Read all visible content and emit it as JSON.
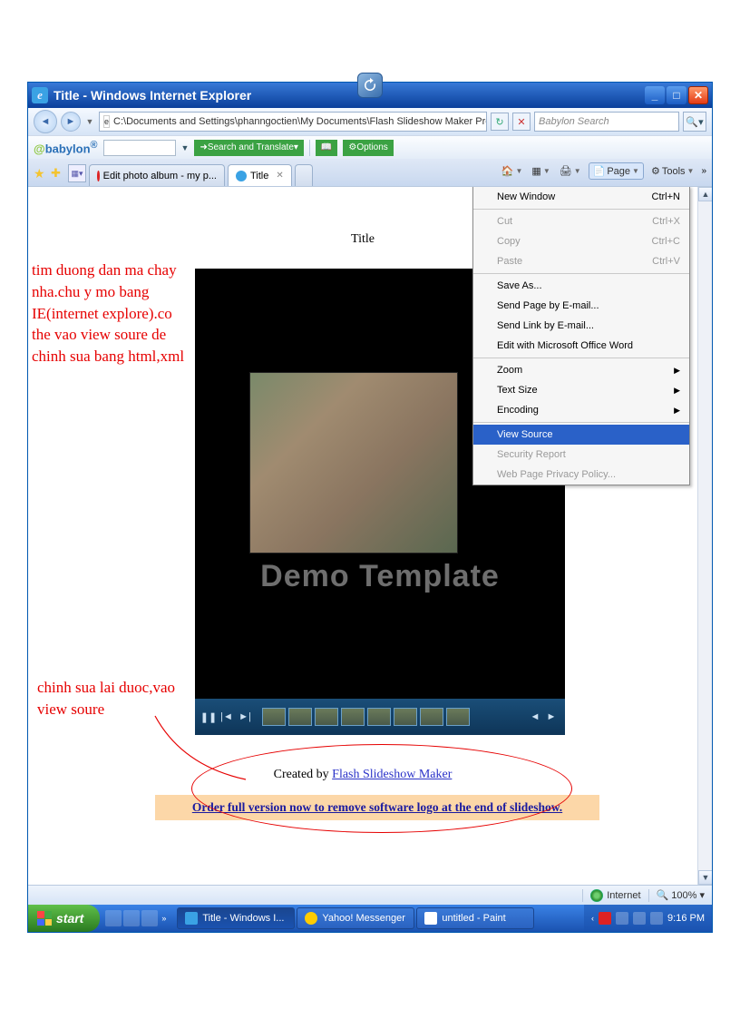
{
  "window": {
    "title": "Title - Windows Internet Explorer",
    "address": "C:\\Documents and Settings\\phanngoctien\\My Documents\\Flash Slideshow Maker Profe...\\output\\ph",
    "search_placeholder": "Babylon Search"
  },
  "babylon": {
    "logo_prefix": "@",
    "logo_text": "babylon",
    "search_btn": "Search and Translate",
    "options": "Options"
  },
  "tabs": {
    "inactive": "Edit photo album - my p...",
    "active": "Title"
  },
  "toolbar": {
    "page": "Page",
    "tools": "Tools"
  },
  "menu": {
    "new_window": "New Window",
    "new_window_sc": "Ctrl+N",
    "cut": "Cut",
    "cut_sc": "Ctrl+X",
    "copy": "Copy",
    "copy_sc": "Ctrl+C",
    "paste": "Paste",
    "paste_sc": "Ctrl+V",
    "save_as": "Save As...",
    "send_page": "Send Page by E-mail...",
    "send_link": "Send Link by E-mail...",
    "edit_word": "Edit with Microsoft Office Word",
    "zoom": "Zoom",
    "text_size": "Text Size",
    "encoding": "Encoding",
    "view_source": "View Source",
    "security_report": "Security Report",
    "privacy": "Web Page Privacy Policy..."
  },
  "page": {
    "title": "Title",
    "watermark": "Demo Template",
    "created_prefix": "Created by ",
    "created_link": "Flash Slideshow Maker",
    "order_link": "Order full version now to remove software logo at the end of slideshow."
  },
  "annotations": {
    "note1": "tim duong dan ma chay nha.chu y mo bang IE(internet explore).co the vao view soure de chinh sua bang html,xml",
    "note2": "chinh sua lai duoc,vao view soure"
  },
  "status": {
    "zone": "Internet",
    "zoom": "100%"
  },
  "taskbar": {
    "start": "start",
    "task1": "Title - Windows I...",
    "task2": "Yahoo! Messenger",
    "task3": "untitled - Paint",
    "clock": "9:16 PM"
  }
}
